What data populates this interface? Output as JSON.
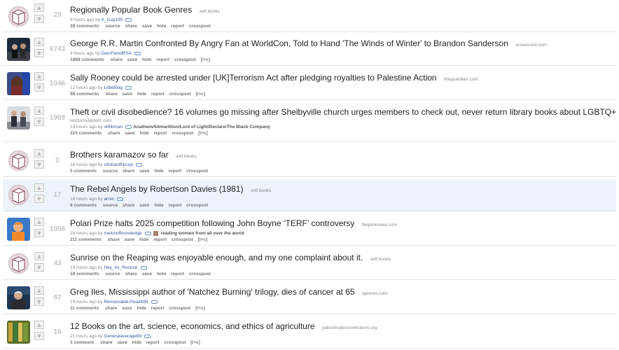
{
  "posts": [
    {
      "score": "20",
      "title": "Regionally Popular Book Genres",
      "domain": "self.books",
      "time": "9 hours ago by",
      "user": "A_Guy195",
      "comments": "28 comments",
      "actions": [
        "source",
        "share",
        "save",
        "hide",
        "report",
        "crosspost"
      ],
      "thumb": "self-post-icon"
    },
    {
      "score": "6743",
      "title": "George R.R. Martin Confronted By Angry Fan at WorldCon, Told to Hand 'The Winds of Winter' to Brandon Sanderson",
      "domain": "screenrant.com",
      "time": "9 hours ago by",
      "user": "DemFiendRSA",
      "comments": "1868 comments",
      "actions": [
        "share",
        "save",
        "hide",
        "report",
        "crosspost",
        "[l+c]"
      ],
      "thumb": "photo-thumbnail"
    },
    {
      "score": "1046",
      "title": "Sally Rooney could be arrested under [UK]Terrorism Act after pledging royalties to Palestine Action",
      "domain": "theguardian.com",
      "time": "12 hours ago by",
      "user": "LittleBlag",
      "comments": "98 comments",
      "actions": [
        "share",
        "save",
        "hide",
        "report",
        "crosspost",
        "[l+c]"
      ],
      "thumb": "photo-thumbnail"
    },
    {
      "score": "1969",
      "title": "Theft or civil disobedience? 16 volumes go missing after Shelbyville church urges members to check out, never return library books about LGBTQ+ people",
      "domain": "kentuckylantern.com",
      "time": "13 hours ago by",
      "user": "reflibman",
      "flair": "Anathem/Silmarillion/Lord of Light/Declare/The Black Company",
      "comments": "323 comments",
      "actions": [
        "share",
        "save",
        "hide",
        "report",
        "crosspost",
        "[l+c]"
      ],
      "thumb": "photo-thumbnail"
    },
    {
      "score": "0",
      "title": "Brothers karamazov so far",
      "domain": "self.books",
      "time": "16 hours ago by",
      "user": "chobaniflipcup",
      "comments": "5 comments",
      "actions": [
        "source",
        "share",
        "save",
        "hide",
        "report",
        "crosspost"
      ],
      "thumb": "self-post-icon"
    },
    {
      "score": "17",
      "title": "The Rebel Angels by Robertson Davies (1981)",
      "domain": "self.books",
      "time": "18 hours ago by",
      "user": "arrec",
      "comments": "8 comments",
      "actions": [
        "source",
        "share",
        "save",
        "hide",
        "report",
        "crosspost"
      ],
      "thumb": "self-post-icon"
    },
    {
      "score": "1058",
      "title": "Polari Prize halts 2025 competition following John Boyne ‘TERF’ controversy",
      "domain": "thepinknews.com",
      "time": "18 hours ago by",
      "user": "melonofknowledge",
      "flair": "reading women from all over the world",
      "comments": "211 comments",
      "actions": [
        "share",
        "save",
        "hide",
        "report",
        "crosspost",
        "[l+c]"
      ],
      "thumb": "photo-thumbnail"
    },
    {
      "score": "43",
      "title": "Sunrise on the Reaping was enjoyable enough, and my one complaint about it.",
      "domain": "self.books",
      "time": "19 hours ago by",
      "user": "Hey_Its_Roomie",
      "comments": "18 comments",
      "actions": [
        "source",
        "share",
        "save",
        "hide",
        "report",
        "crosspost"
      ],
      "thumb": "self-post-icon"
    },
    {
      "score": "87",
      "title": "Greg Iles, Mississippi author of 'Natchez Burning' trilogy, dies of cancer at 65",
      "domain": "apnews.com",
      "time": "19 hours ago by",
      "user": "Remarkable-Pea4889",
      "comments": "11 comments",
      "actions": [
        "share",
        "save",
        "hide",
        "report",
        "crosspost",
        "[l+c]"
      ],
      "thumb": "photo-thumbnail"
    },
    {
      "score": "16",
      "title": "12 Books on the art, science, economics, and ethics of agriculture",
      "domain": "yaleclimateconnections.org",
      "time": "21 hours ago by",
      "user": "Generalaverage89",
      "comments": "1 comment",
      "actions": [
        "share",
        "save",
        "hide",
        "report",
        "crosspost",
        "[l+c]"
      ],
      "thumb": "photo-thumbnail"
    }
  ]
}
